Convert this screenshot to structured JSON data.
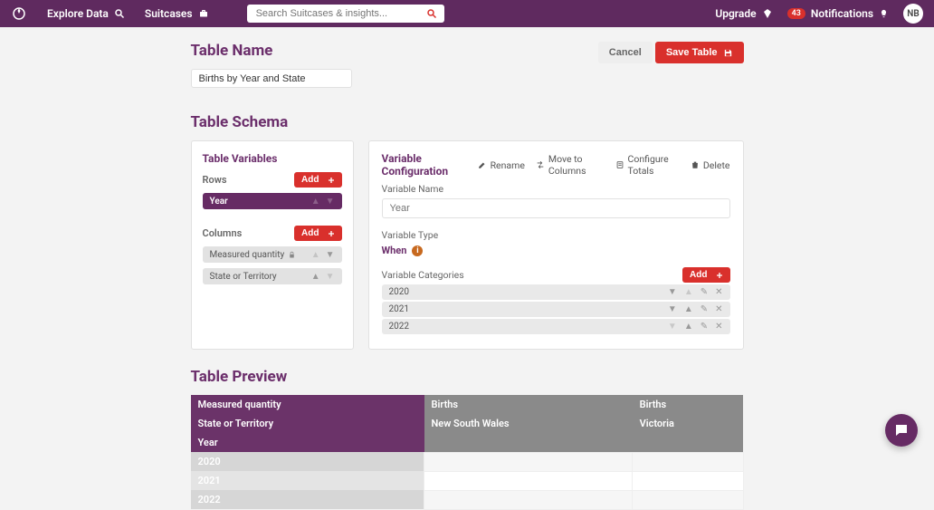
{
  "nav": {
    "explore": "Explore Data",
    "suitcases": "Suitcases",
    "search_placeholder": "Search Suitcases & insights...",
    "upgrade": "Upgrade",
    "notif_count": "43",
    "notifications": "Notifications",
    "avatar": "NB"
  },
  "titles": {
    "table_name": "Table Name",
    "cancel": "Cancel",
    "save": "Save Table",
    "table_schema": "Table Schema",
    "table_preview": "Table Preview"
  },
  "table_name_value": "Births by Year and State",
  "vars": {
    "title": "Table Variables",
    "rows_label": "Rows",
    "cols_label": "Columns",
    "add": "Add",
    "row_items": [
      "Year"
    ],
    "col_items": [
      "Measured quantity",
      "State or Territory"
    ]
  },
  "config": {
    "title": "Variable Configuration",
    "actions": {
      "rename": "Rename",
      "move": "Move to Columns",
      "totals": "Configure Totals",
      "delete": "Delete"
    },
    "name_label": "Variable Name",
    "name_placeholder": "Year",
    "type_label": "Variable Type",
    "type_value": "When",
    "categories_label": "Variable Categories",
    "add": "Add",
    "categories": [
      "2020",
      "2021",
      "2022"
    ]
  },
  "preview": {
    "mq": "Measured quantity",
    "state": "State or Territory",
    "year": "Year",
    "births": "Births",
    "nsw": "New South Wales",
    "vic": "Victoria",
    "rows": [
      "2020",
      "2021",
      "2022"
    ]
  }
}
